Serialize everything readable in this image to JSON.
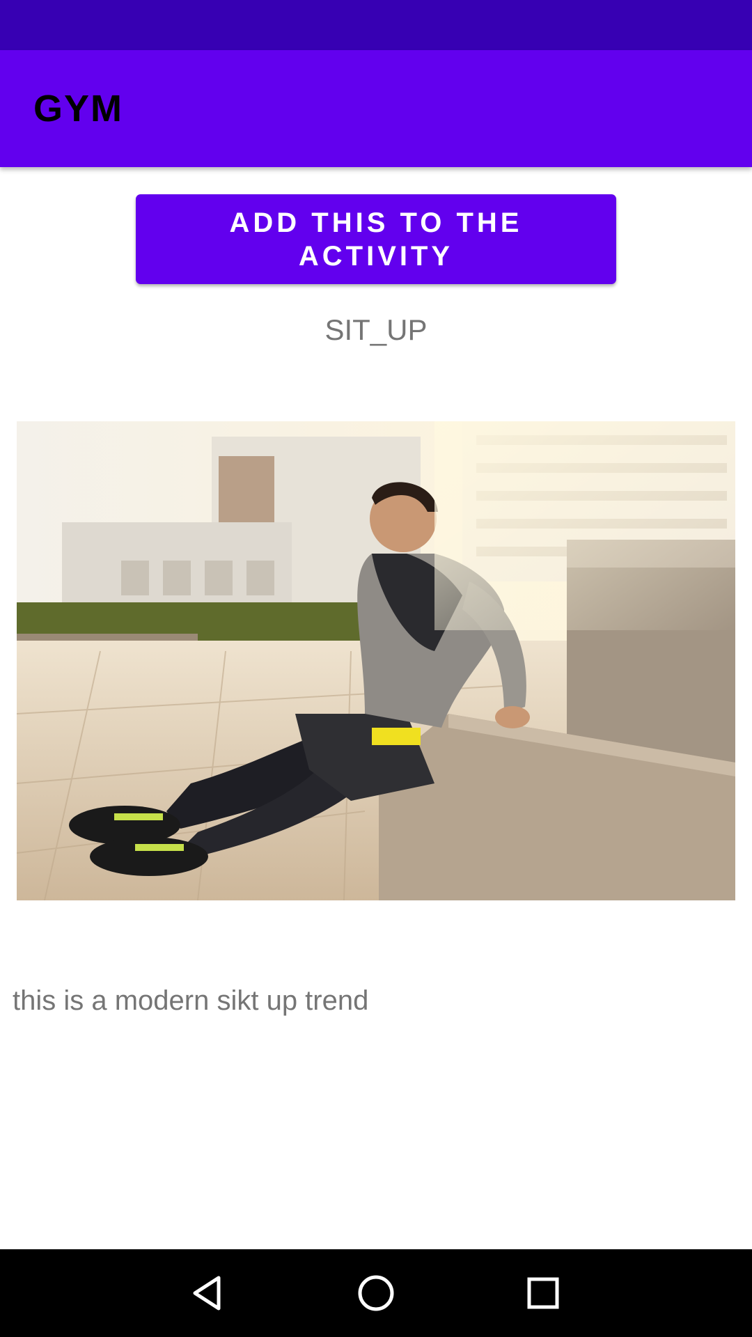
{
  "app_bar": {
    "title": "GYM"
  },
  "content": {
    "add_button_label": "ADD THIS TO THE ACTIVITY",
    "exercise_name": "SIT_UP",
    "description": "this is a modern sikt up trend"
  },
  "nav_bar": {
    "back_icon": "triangle-back-icon",
    "home_icon": "circle-home-icon",
    "recents_icon": "square-recents-icon"
  },
  "colors": {
    "status_bar": "#3700b3",
    "primary": "#6200ee",
    "text_secondary": "#757575",
    "nav_bar": "#000000"
  }
}
